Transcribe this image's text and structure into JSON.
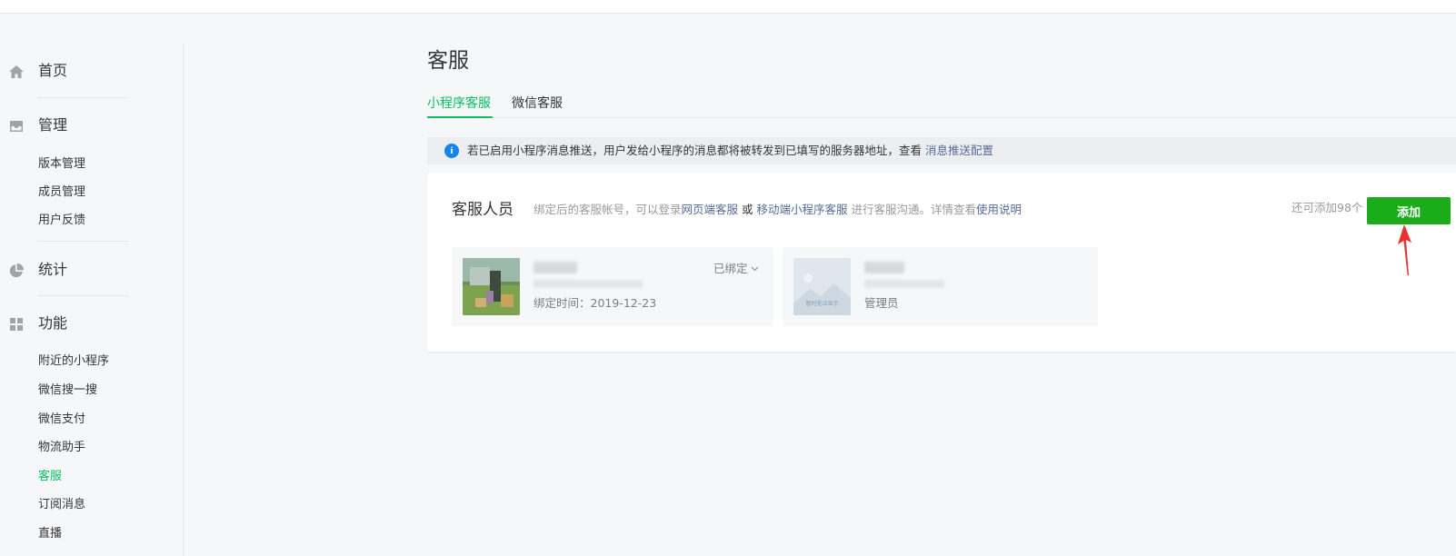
{
  "sidebar": {
    "home": {
      "label": "首页",
      "icon": "home-icon"
    },
    "manage": {
      "label": "管理",
      "icon": "inbox-icon",
      "items": [
        {
          "label": "版本管理"
        },
        {
          "label": "成员管理"
        },
        {
          "label": "用户反馈"
        }
      ]
    },
    "stats": {
      "label": "统计",
      "icon": "pie-chart-icon"
    },
    "features": {
      "label": "功能",
      "icon": "grid-icon",
      "items": [
        {
          "label": "附近的小程序"
        },
        {
          "label": "微信搜一搜"
        },
        {
          "label": "微信支付"
        },
        {
          "label": "物流助手"
        },
        {
          "label": "客服",
          "active": true
        },
        {
          "label": "订阅消息"
        },
        {
          "label": "直播"
        }
      ]
    }
  },
  "page": {
    "title": "客服",
    "tabs": [
      {
        "label": "小程序客服",
        "active": true
      },
      {
        "label": "微信客服"
      }
    ],
    "notice": {
      "text": "若已启用小程序消息推送，用户发给小程序的消息都将被转发到已填写的服务器地址，查看",
      "link": "消息推送配置"
    }
  },
  "panel": {
    "title": "客服人员",
    "desc_prefix": "绑定后的客服帐号，可以登录",
    "desc_link1": "网页端客服",
    "desc_mid": " 或 ",
    "desc_link2": "移动端小程序客服",
    "desc_suffix": " 进行客服沟通。详情查看",
    "desc_link3": "使用说明",
    "quota": "还可添加98个",
    "add_label": "添加",
    "cards": [
      {
        "status": "已绑定",
        "meta": "绑定时间：2019-12-23"
      },
      {
        "meta": "管理员",
        "placeholder_text": "暂时无法显示"
      }
    ]
  },
  "colors": {
    "accent": "#07c160",
    "button": "#1aad19",
    "link": "#576b95",
    "info": "#1485ee",
    "arrow": "#e8322c"
  }
}
